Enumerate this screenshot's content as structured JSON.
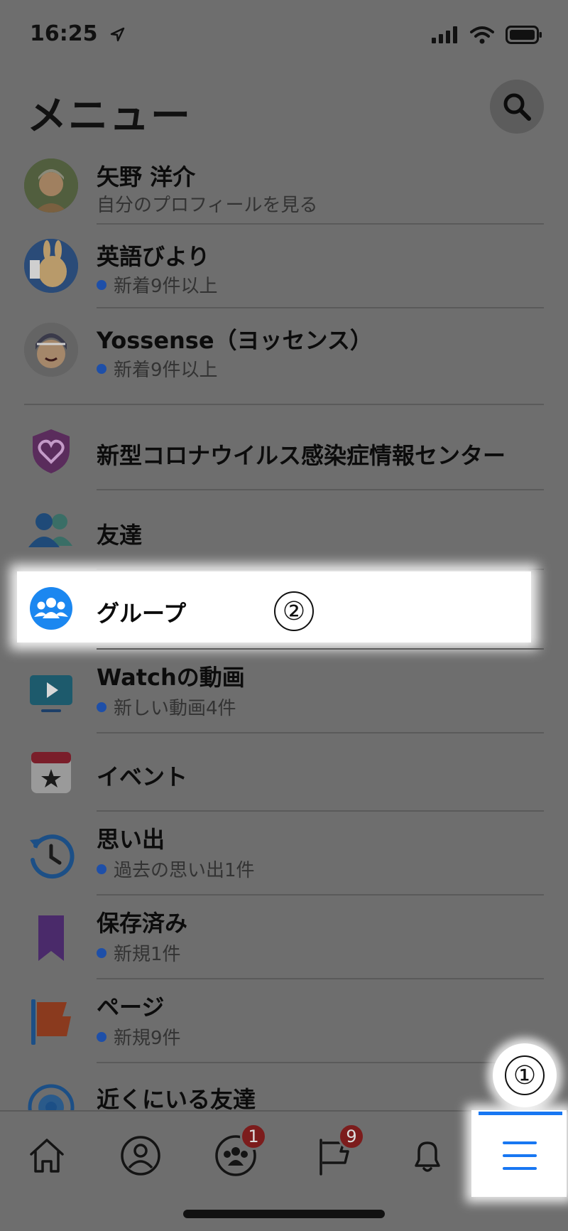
{
  "status": {
    "time": "16:25"
  },
  "header": {
    "title": "メニュー"
  },
  "profiles": [
    {
      "name": "矢野 洋介",
      "sub": "自分のプロフィールを見る",
      "dot": false
    },
    {
      "name": "英語びより",
      "sub": "新着9件以上",
      "dot": true
    },
    {
      "name": "Yossense（ヨッセンス）",
      "sub": "新着9件以上",
      "dot": true
    }
  ],
  "menu_items": [
    {
      "title": "新型コロナウイルス感染症情報センター",
      "sub": ""
    },
    {
      "title": "友達",
      "sub": ""
    },
    {
      "title": "グループ",
      "sub": ""
    },
    {
      "title": "Watchの動画",
      "sub": "新しい動画4件"
    },
    {
      "title": "イベント",
      "sub": ""
    },
    {
      "title": "思い出",
      "sub": "過去の思い出1件"
    },
    {
      "title": "保存済み",
      "sub": "新規1件"
    },
    {
      "title": "ページ",
      "sub": "新規9件"
    },
    {
      "title": "近くにいる友達",
      "sub": ""
    }
  ],
  "annotations": {
    "step1": "①",
    "step2": "②"
  },
  "tabbar": {
    "tabs": [
      {
        "icon": "home-icon"
      },
      {
        "icon": "profile-icon"
      },
      {
        "icon": "groups-icon",
        "badge": "1"
      },
      {
        "icon": "pages-flag-icon",
        "badge": "9"
      },
      {
        "icon": "bell-icon"
      },
      {
        "icon": "menu-icon"
      }
    ]
  },
  "colors": {
    "accent": "#1877f2",
    "badge": "#e41e3f",
    "overlay": "#6e6e6e"
  }
}
